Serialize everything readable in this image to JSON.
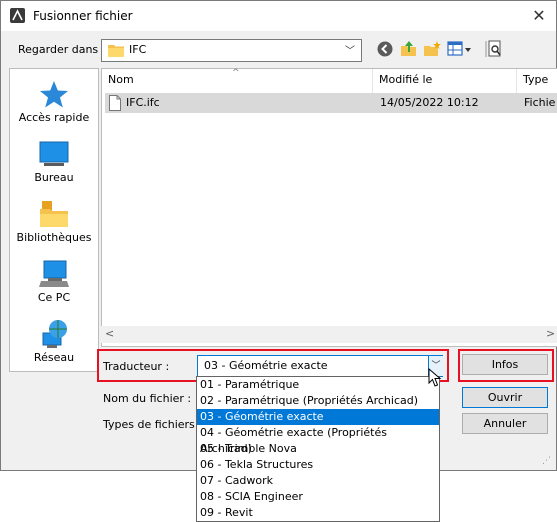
{
  "window": {
    "title": "Fusionner fichier",
    "close_glyph": "✕"
  },
  "toolbar": {
    "lookin_label": "Regarder dans :",
    "lookin_value": "IFC",
    "icons": [
      "back-icon",
      "up-folder-icon",
      "new-folder-icon",
      "view-menu-icon",
      "preview-icon"
    ]
  },
  "places": [
    {
      "label": "Accès rapide",
      "icon": "star-icon"
    },
    {
      "label": "Bureau",
      "icon": "desktop-icon"
    },
    {
      "label": "Bibliothèques",
      "icon": "library-icon"
    },
    {
      "label": "Ce PC",
      "icon": "computer-icon"
    },
    {
      "label": "Réseau",
      "icon": "network-icon"
    }
  ],
  "filelist": {
    "columns": [
      "Nom",
      "Modifié le",
      "Type"
    ],
    "rows": [
      {
        "name": "IFC.ifc",
        "modified": "14/05/2022 10:12",
        "type": "Fichie"
      }
    ]
  },
  "form": {
    "translator_label": "Traducteur :",
    "translator_value": "03 - Géométrie exacte",
    "filename_label": "Nom du fichier :",
    "filetype_label": "Types de fichiers :"
  },
  "buttons": {
    "infos": "Infos",
    "open": "Ouvrir",
    "cancel": "Annuler"
  },
  "translator_options": [
    "01 - Paramétrique",
    "02 - Paramétrique (Propriétés Archicad)",
    "03 - Géométrie exacte",
    "04 - Géométrie exacte (Propriétés Archicad)",
    "05 - Trimble Nova",
    "06 - Tekla Structures",
    "07 - Cadwork",
    "08 - SCIA Engineer",
    "09 - Revit"
  ],
  "selected_option_index": 2,
  "colors": {
    "accent": "#0078d7",
    "highlight": "#e81123",
    "selection": "#0078d7"
  }
}
